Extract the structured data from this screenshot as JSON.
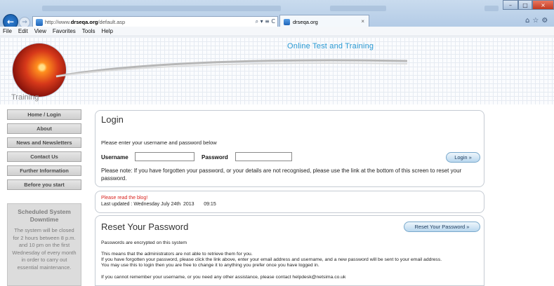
{
  "browser": {
    "url_prefix": "http://www.",
    "url_domain": "drseqa.org",
    "url_path": "/default.asp",
    "address_tools": "⌕ ▾ ≡ C",
    "tab_title": "drseqa.org",
    "tab_close": "×",
    "back": "←",
    "forward": "→",
    "window_min": "–",
    "window_max": "□",
    "window_close": "×",
    "chrome_icons": "⌂☆⚙"
  },
  "menu": [
    "File",
    "Edit",
    "View",
    "Favorites",
    "Tools",
    "Help"
  ],
  "header": {
    "banner_title": "Online Test and Training",
    "training_label": "Training"
  },
  "sidebar": {
    "items": [
      {
        "label": "Home / Login"
      },
      {
        "label": "About"
      },
      {
        "label": "News and Newsletters"
      },
      {
        "label": "Contact Us"
      },
      {
        "label": "Further Information"
      },
      {
        "label": "Before you start"
      }
    ],
    "downtime": {
      "title": "Scheduled System Downtime",
      "body": "The system will be closed for 2 hours between 8 p.m. and 10 pm on the first Wednesday of every month in order to carry out essential maintenance."
    }
  },
  "login": {
    "title": "Login",
    "instruction": "Please enter your username and password below",
    "username_label": "Username",
    "password_label": "Password",
    "username_value": "",
    "password_value": "",
    "button": "Login »",
    "note": "Please note: If you have forgotten your password, or your details are not recognised, please use the link at the bottom of this screen to reset your password."
  },
  "blog": {
    "link": "Please read the blog!",
    "updated": "Last updated : Wednesday July 24th  2013       09:15"
  },
  "reset": {
    "title": "Reset Your Password",
    "button": "Reset Your Password »",
    "line1": "Passwords are encrypted on this system",
    "line2": "This means that the administrators are not able to retrieve them for you.",
    "line3": "If you have forgotten your password, please click the link above, enter your email address and username, and a new password will be sent to your email address.",
    "line4": "You may use this to login then you are free to change it to anything you prefer once you have logged in.",
    "line5": "If you cannot remember your username, or you need any other assistance, please contact helpdesk@netsima.co.uk"
  },
  "colors": {
    "banner_title": "#2a9ad3",
    "blog_link": "#d8231f",
    "sidebar_button": "#d6d6d6",
    "downtime_box": "#dcdcdc"
  }
}
